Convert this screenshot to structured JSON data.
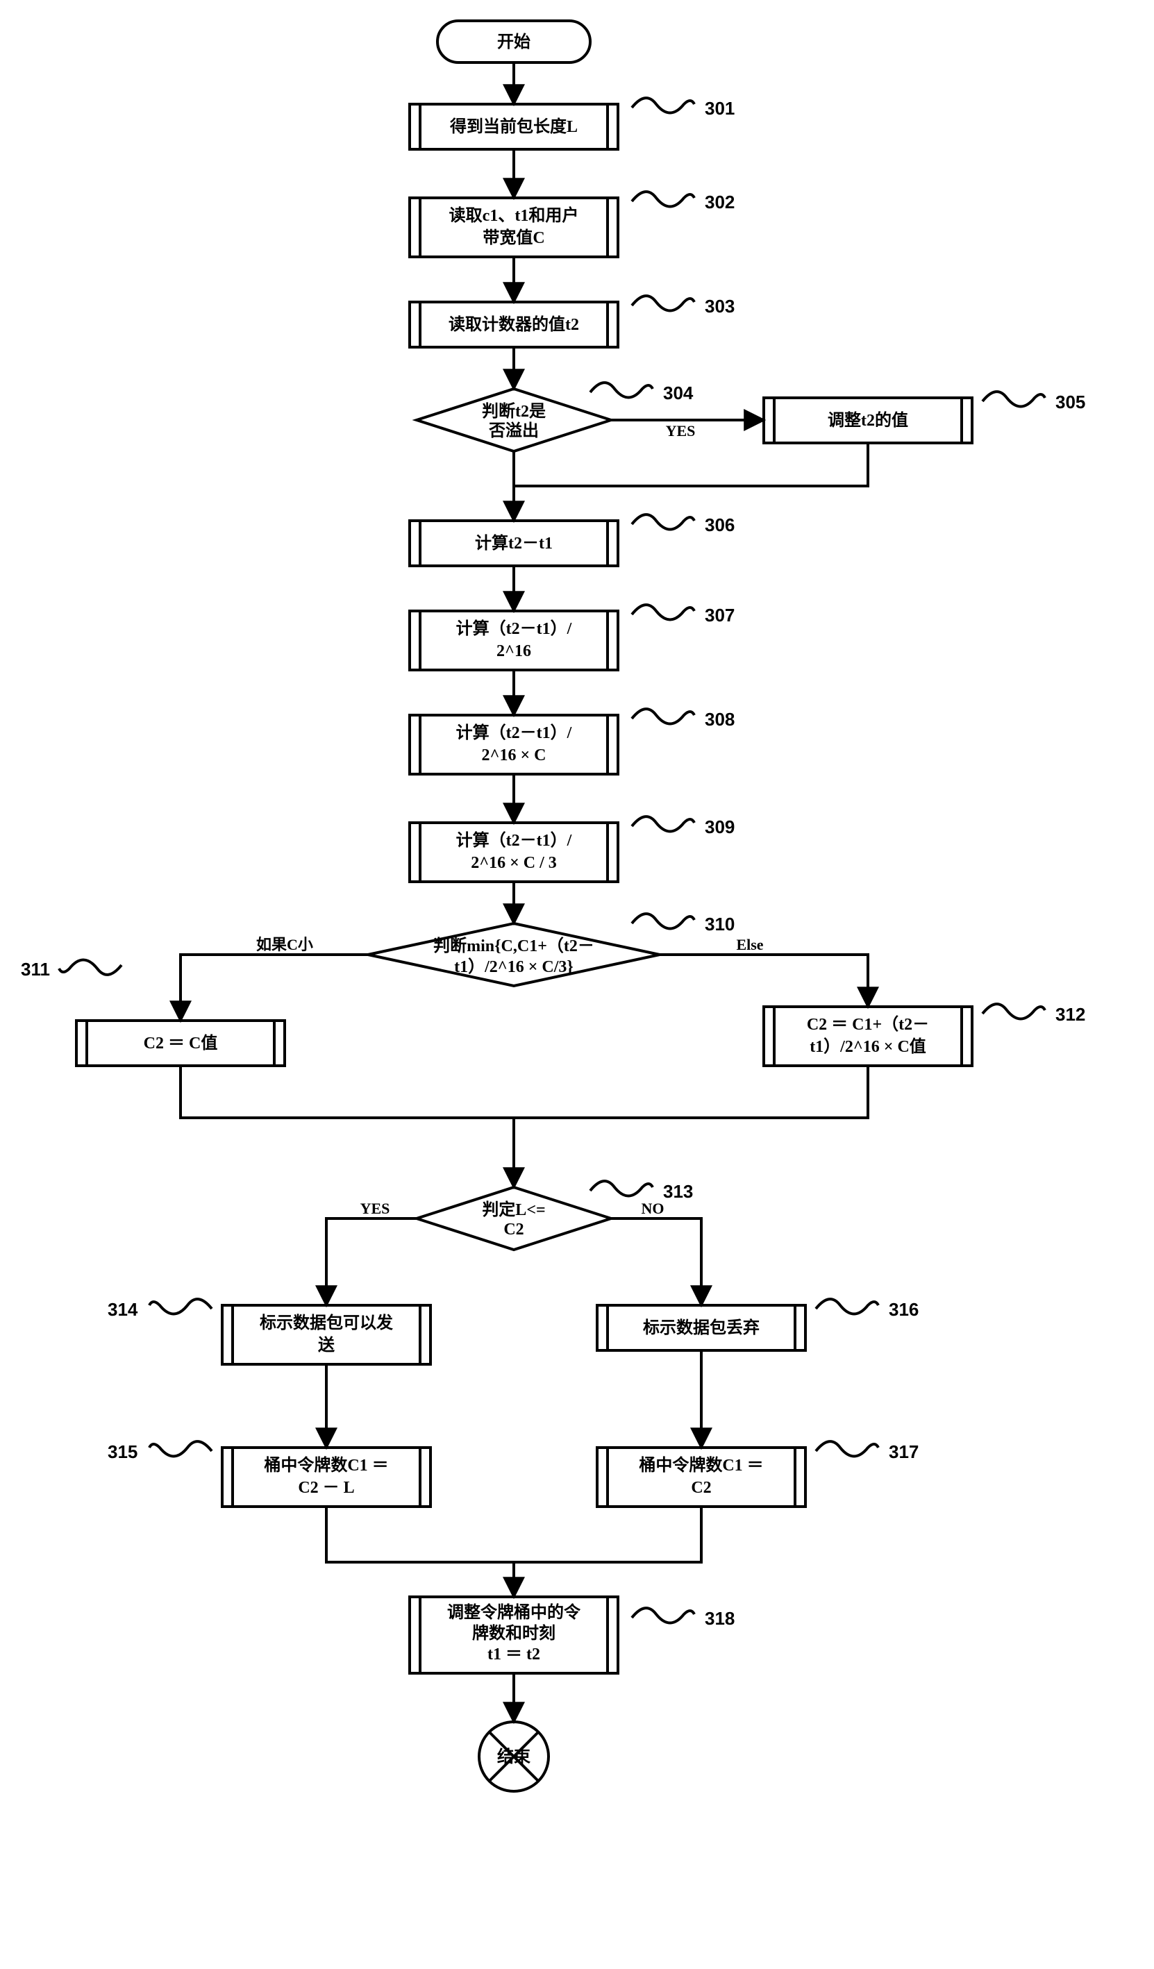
{
  "nodes": {
    "start": "开始",
    "n301": "得到当前包长度L",
    "n302_l1": "读取c1、t1和用户",
    "n302_l2": "带宽值C",
    "n303": "读取计数器的值t2",
    "n304_l1": "判断t2是",
    "n304_l2": "否溢出",
    "n305": "调整t2的值",
    "n306": "计算t2－t1",
    "n307_l1": "计算（t2－t1）/",
    "n307_l2": "2^16",
    "n308_l1": "计算（t2－t1）/",
    "n308_l2": "2^16 × C",
    "n309_l1": "计算（t2－t1）/",
    "n309_l2": "2^16 × C / 3",
    "n310_l1": "判断min{C,C1+（t2－",
    "n310_l2": "t1）/2^16 × C/3}",
    "n311": "C2 ＝ C值",
    "n312_l1": "C2 ＝ C1+（t2－",
    "n312_l2": "t1）/2^16 × C值",
    "n313_l1": "判定L<=",
    "n313_l2": "C2",
    "n314_l1": "标示数据包可以发",
    "n314_l2": "送",
    "n315_l1": "桶中令牌数C1 ＝",
    "n315_l2": "C2 － L",
    "n316": "标示数据包丢弃",
    "n317_l1": "桶中令牌数C1 ＝",
    "n317_l2": "C2",
    "n318_l1": "调整令牌桶中的令",
    "n318_l2": "牌数和时刻",
    "n318_l3": "t1 ＝ t2",
    "end": "结束"
  },
  "labels": {
    "l301": "301",
    "l302": "302",
    "l303": "303",
    "l304": "304",
    "l305": "305",
    "l306": "306",
    "l307": "307",
    "l308": "308",
    "l309": "309",
    "l310": "310",
    "l311": "311",
    "l312": "312",
    "l313": "313",
    "l314": "314",
    "l315": "315",
    "l316": "316",
    "l317": "317",
    "l318": "318"
  },
  "edges": {
    "yes_304": "YES",
    "edge310_left": "如果C小",
    "edge310_right": "Else",
    "yes_313": "YES",
    "no_313": "NO"
  }
}
